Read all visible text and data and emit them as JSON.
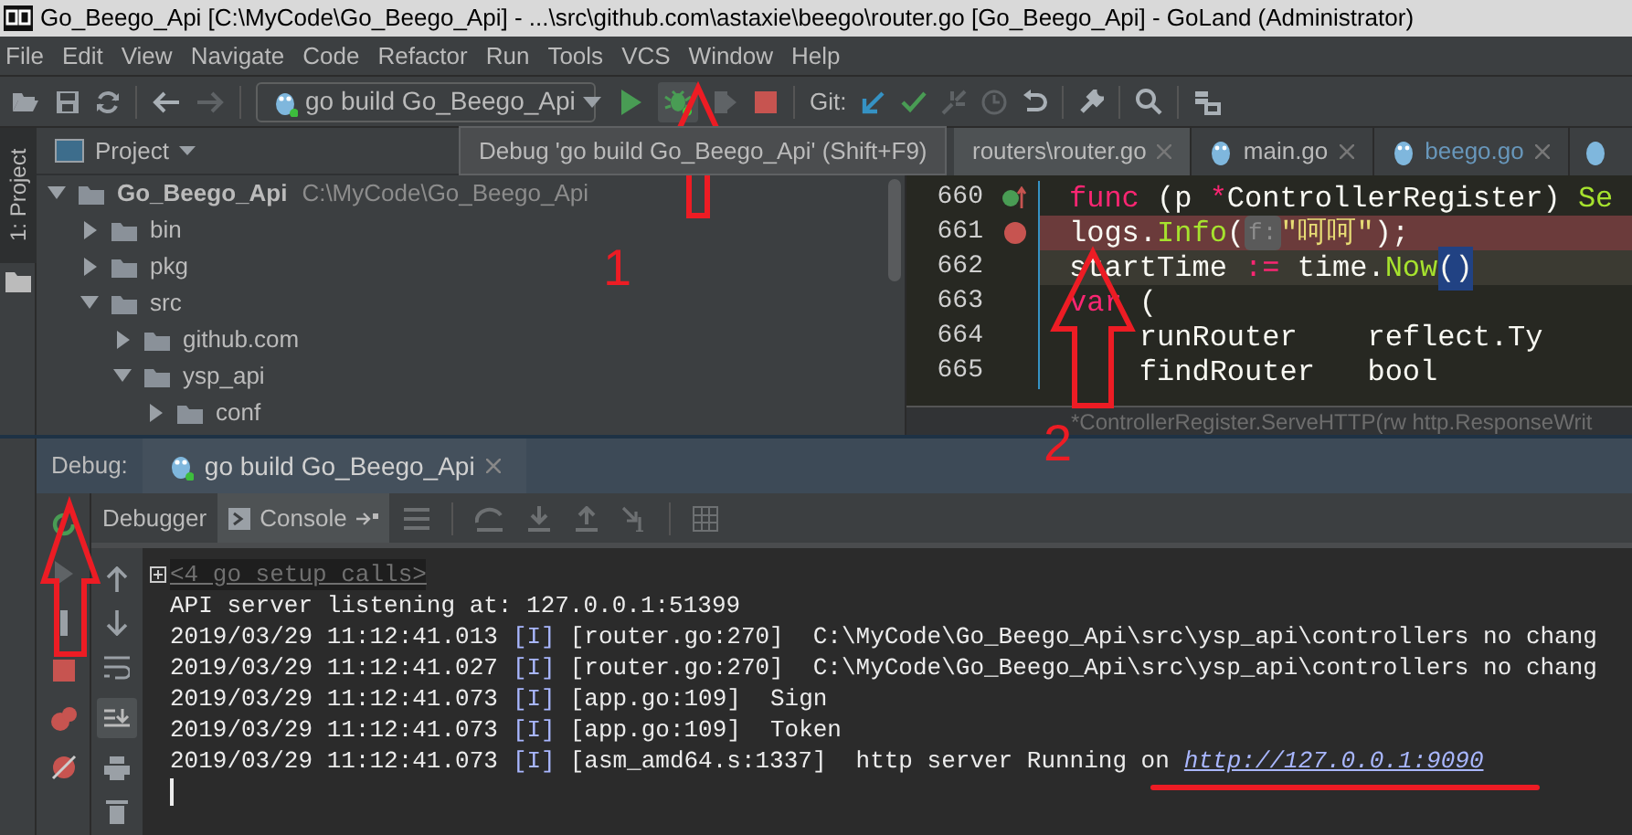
{
  "window": {
    "title": "Go_Beego_Api [C:\\MyCode\\Go_Beego_Api] - ...\\src\\github.com\\astaxie\\beego\\router.go [Go_Beego_Api] - GoLand (Administrator)"
  },
  "menu": [
    "File",
    "Edit",
    "View",
    "Navigate",
    "Code",
    "Refactor",
    "Run",
    "Tools",
    "VCS",
    "Window",
    "Help"
  ],
  "toolbar": {
    "run_config": "go build Go_Beego_Api",
    "git_label": "Git:"
  },
  "tooltip": "Debug 'go build Go_Beego_Api' (Shift+F9)",
  "side_strip": {
    "tab": "1: Project",
    "selected": true
  },
  "project": {
    "title": "Project",
    "tree": [
      {
        "name": "Go_Beego_Api",
        "path": "C:\\MyCode\\Go_Beego_Api",
        "expanded": true,
        "children": [
          {
            "name": "bin",
            "expanded": false
          },
          {
            "name": "pkg",
            "expanded": false
          },
          {
            "name": "src",
            "expanded": true,
            "children": [
              {
                "name": "github.com",
                "expanded": false
              },
              {
                "name": "ysp_api",
                "expanded": true,
                "children": [
                  {
                    "name": "conf",
                    "expanded": false
                  }
                ]
              }
            ]
          }
        ]
      }
    ]
  },
  "editor": {
    "tabs": [
      {
        "label": "routers\\router.go",
        "selected": true
      },
      {
        "label": "main.go",
        "selected": false
      },
      {
        "label": "beego.go",
        "selected": false
      }
    ],
    "lines": [
      {
        "number": "660",
        "breakpoint": false,
        "execution_point": false,
        "tokens": [
          {
            "t": "func",
            "kind": "kw"
          },
          {
            "t": " (p ",
            "kind": "plain"
          },
          {
            "t": "*",
            "kind": "kw"
          },
          {
            "t": "ControllerRegister) ",
            "kind": "plain"
          },
          {
            "t": "Se",
            "kind": "fn"
          }
        ]
      },
      {
        "number": "661",
        "breakpoint": true,
        "execution_point": false,
        "tokens": [
          {
            "t": "logs.",
            "kind": "plain"
          },
          {
            "t": "Info",
            "kind": "fn"
          },
          {
            "t": "(",
            "kind": "plain"
          },
          {
            "t": "f:",
            "kind": "hint"
          },
          {
            "t": "\"呵呵\"",
            "kind": "str"
          },
          {
            "t": ");",
            "kind": "plain"
          }
        ]
      },
      {
        "number": "662",
        "breakpoint": false,
        "execution_point": true,
        "tokens": [
          {
            "t": "startTime ",
            "kind": "plain"
          },
          {
            "t": ":=",
            "kind": "kw"
          },
          {
            "t": " time.",
            "kind": "plain"
          },
          {
            "t": "Now",
            "kind": "fn"
          },
          {
            "t": "()",
            "kind": "match"
          }
        ]
      },
      {
        "number": "663",
        "breakpoint": false,
        "execution_point": false,
        "tokens": [
          {
            "t": "var",
            "kind": "kw"
          },
          {
            "t": " (",
            "kind": "plain"
          }
        ]
      },
      {
        "number": "664",
        "breakpoint": false,
        "execution_point": false,
        "tokens": [
          {
            "t": "    runRouter    reflect.Ty",
            "kind": "plain"
          }
        ]
      },
      {
        "number": "665",
        "breakpoint": false,
        "execution_point": false,
        "tokens": [
          {
            "t": "    findRouter   bool",
            "kind": "plain"
          }
        ]
      }
    ],
    "breadcrumb": "*ControllerRegister.ServeHTTP(rw http.ResponseWrit"
  },
  "debug": {
    "label": "Debug:",
    "session": "go build Go_Beego_Api",
    "subtabs": [
      {
        "label": "Debugger",
        "selected": false
      },
      {
        "label": "Console",
        "selected": true
      }
    ],
    "console": [
      {
        "kind": "folded",
        "text": "<4 go setup calls>"
      },
      {
        "kind": "plain",
        "text": "API server listening at: 127.0.0.1:51399"
      },
      {
        "kind": "log",
        "time": "2019/03/29 11:12:41.013",
        "level": "[I]",
        "source": "[router.go:270]",
        "message": "C:\\MyCode\\Go_Beego_Api\\src\\ysp_api\\controllers no chang"
      },
      {
        "kind": "log",
        "time": "2019/03/29 11:12:41.027",
        "level": "[I]",
        "source": "[router.go:270]",
        "message": "C:\\MyCode\\Go_Beego_Api\\src\\ysp_api\\controllers no chang"
      },
      {
        "kind": "log",
        "time": "2019/03/29 11:12:41.073",
        "level": "[I]",
        "source": "[app.go:109]",
        "message": "Sign"
      },
      {
        "kind": "log",
        "time": "2019/03/29 11:12:41.073",
        "level": "[I]",
        "source": "[app.go:109]",
        "message": "Token"
      },
      {
        "kind": "log",
        "time": "2019/03/29 11:12:41.073",
        "level": "[I]",
        "source": "[asm_amd64.s:1337]",
        "message": "http server Running on",
        "link": "http://127.0.0.1:9090"
      }
    ]
  },
  "annotations": [
    "1",
    "2"
  ]
}
